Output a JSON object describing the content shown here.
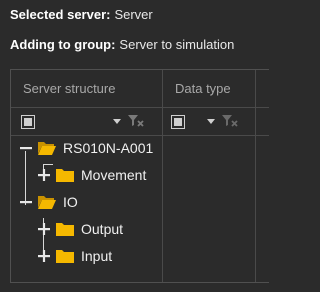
{
  "header": {
    "selected_server_label": "Selected server:",
    "selected_server_value": "Server",
    "adding_group_label": "Adding to group:",
    "adding_group_value": "Server to simulation"
  },
  "grid": {
    "columns": [
      {
        "label": "Server structure"
      },
      {
        "label": "Data type"
      }
    ],
    "tree": [
      {
        "label": "RS010N-A001",
        "expanded": true,
        "level": 0,
        "icon": "folder-open-icon"
      },
      {
        "label": "Movement",
        "expanded": false,
        "level": 1,
        "icon": "folder-icon"
      },
      {
        "label": "IO",
        "expanded": true,
        "level": 0,
        "icon": "folder-open-icon"
      },
      {
        "label": "Output",
        "expanded": false,
        "level": 1,
        "icon": "folder-icon"
      },
      {
        "label": "Input",
        "expanded": false,
        "level": 1,
        "icon": "folder-icon"
      }
    ]
  },
  "colors": {
    "background": "#2b2b2b",
    "folder": "#f5b800",
    "border": "#4a4a4a"
  }
}
